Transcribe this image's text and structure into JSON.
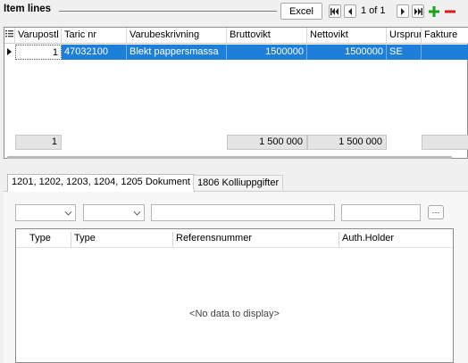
{
  "header": {
    "title": "Item lines",
    "excel_label": "Excel",
    "pager": "1 of 1",
    "first_icon": "first-page-icon",
    "prev_icon": "previous-page-icon",
    "next_icon": "next-page-icon",
    "last_icon": "last-page-icon",
    "add_icon": "plus-icon",
    "remove_icon": "minus-icon"
  },
  "grid": {
    "columns": [
      "Varupostl",
      "Taric nr",
      "Varubeskrivning",
      "Bruttovikt",
      "Nettovikt",
      "Ursprur",
      "Fakture"
    ],
    "row": {
      "varupost": "1",
      "taric": "47032100",
      "beskrivning": "Blekt pappersmassa",
      "brutto": "1500000",
      "netto": "1500000",
      "ursprung": "SE",
      "faktura": ""
    },
    "footer": {
      "count": "1",
      "brutto_sum": "1 500 000",
      "netto_sum": "1 500 000"
    }
  },
  "tabs": [
    {
      "label": "1201, 1202, 1203, 1204, 1205 Dokument",
      "active": true
    },
    {
      "label": "1806 Kolliuppgifter",
      "active": false
    }
  ],
  "documents": {
    "filter_1": "",
    "filter_2": "",
    "filter_3": "",
    "filter_4": "",
    "ellipsis": "···",
    "columns": [
      "Type",
      "Type",
      "Referensnummer",
      "Auth.Holder"
    ],
    "empty_text": "<No data to display>"
  },
  "colors": {
    "selection": "#1e7fdb",
    "add": "#1aa31a",
    "remove": "#d61c1c"
  }
}
